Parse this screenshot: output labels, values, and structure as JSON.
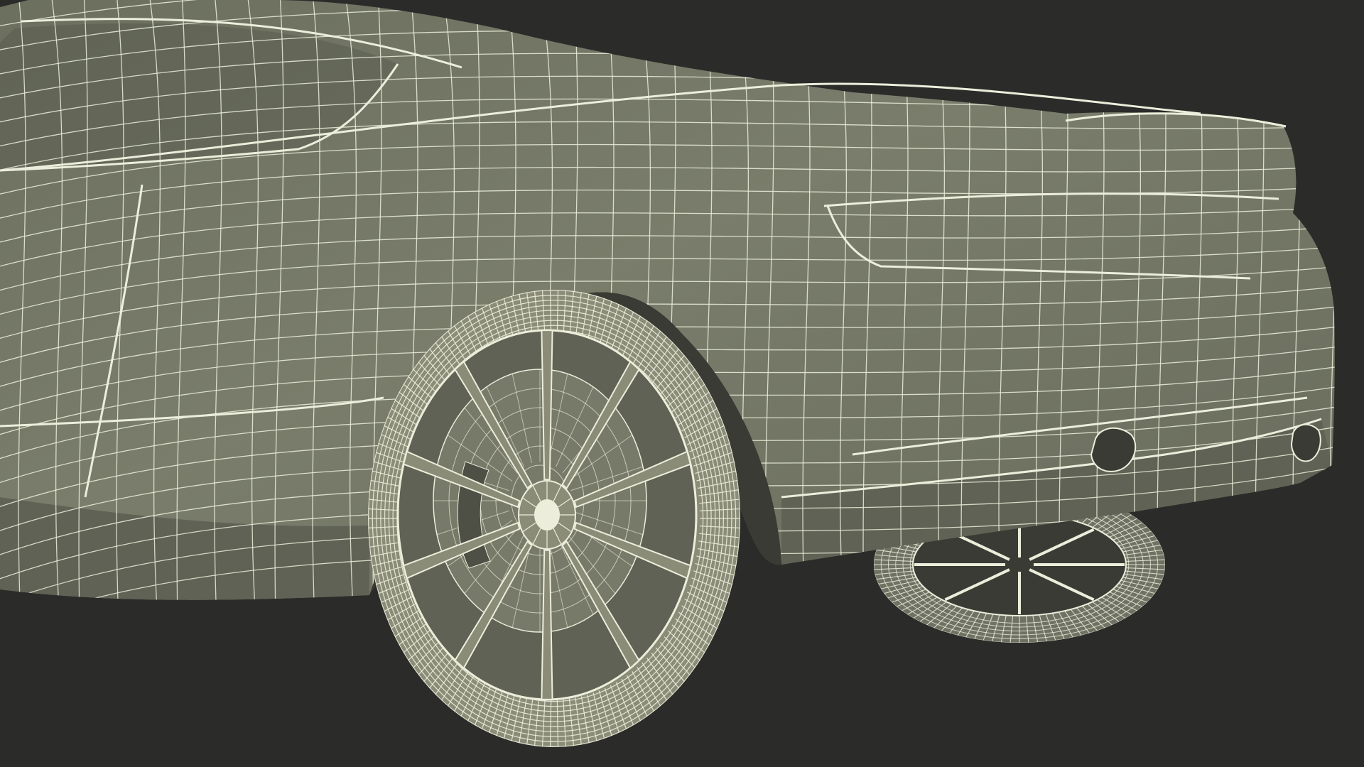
{
  "scene": {
    "subject": "wireframe-sports-car-rear",
    "colors": {
      "background": "#2b2b2a",
      "surface": "#777a68",
      "surface_shadow": "#5f6254",
      "surface_dark": "#4e5046",
      "wire": "#eceedb",
      "tire": "#8a8c78",
      "tire_dark": "#6f7163",
      "cavity": "#3a3b35"
    },
    "rear_wheel": {
      "spokes": 10
    },
    "far_wheel": {
      "spokes": 8
    }
  }
}
